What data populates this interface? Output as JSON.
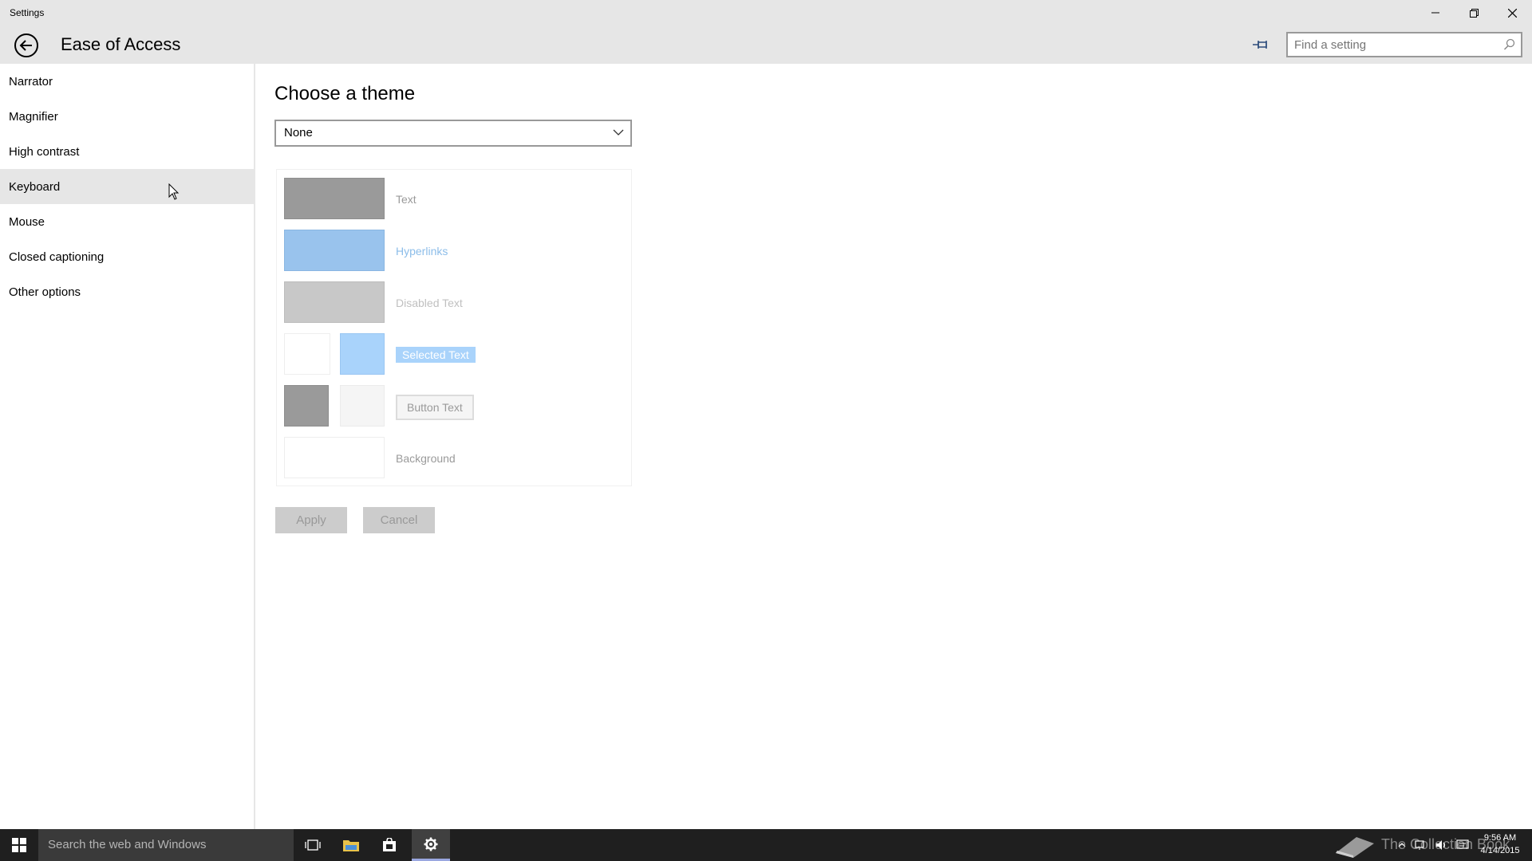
{
  "window": {
    "title": "Settings"
  },
  "header": {
    "title": "Ease of Access",
    "search_placeholder": "Find a setting"
  },
  "sidebar": {
    "items": [
      {
        "label": "Narrator"
      },
      {
        "label": "Magnifier"
      },
      {
        "label": "High contrast"
      },
      {
        "label": "Keyboard"
      },
      {
        "label": "Mouse"
      },
      {
        "label": "Closed captioning"
      },
      {
        "label": "Other options"
      }
    ],
    "active": "Keyboard"
  },
  "main": {
    "heading": "Choose a theme",
    "theme_select": {
      "value": "None"
    },
    "preview": {
      "text": "Text",
      "hyperlinks": "Hyperlinks",
      "disabled_text": "Disabled Text",
      "selected_text": "Selected Text",
      "button_text": "Button Text",
      "background": "Background"
    },
    "apply_label": "Apply",
    "cancel_label": "Cancel"
  },
  "colors": {
    "text_swatch": "#9a9a9a",
    "hyperlink_swatch": "#99c3ed",
    "disabled_swatch": "#c8c8c8",
    "selected_bg_swatch": "#a9d3fb",
    "button_swatch": "#9a9a9a",
    "button_face_swatch": "#f5f5f5",
    "background_swatch": "#ffffff",
    "header_bg": "#e6e6e6",
    "taskbar_bg": "#1f1f1f"
  },
  "taskbar": {
    "search_placeholder": "Search the web and Windows",
    "watermark": "The Collection Book",
    "clock_time": "9:56 AM",
    "clock_date": "4/14/2015"
  }
}
